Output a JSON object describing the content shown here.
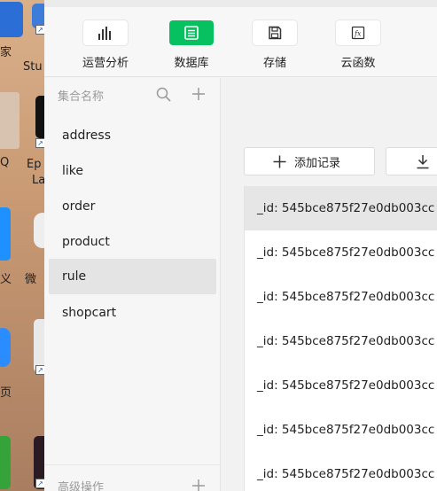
{
  "desktop": {
    "labels": [
      "家",
      "Stu",
      "Q",
      "Ep",
      "La",
      "义",
      "微",
      "页"
    ]
  },
  "toolbar": {
    "items": [
      {
        "label": "运营分析",
        "icon": "bar-chart-icon",
        "active": false
      },
      {
        "label": "数据库",
        "icon": "database-icon",
        "active": true
      },
      {
        "label": "存储",
        "icon": "save-icon",
        "active": false
      },
      {
        "label": "云函数",
        "icon": "function-icon",
        "active": false
      }
    ]
  },
  "sidebar": {
    "title": "集合名称",
    "collections": [
      "address",
      "like",
      "order",
      "product",
      "rule",
      "shopcart"
    ],
    "selected": "rule",
    "footer": "高级操作"
  },
  "main": {
    "add_record_label": "添加记录",
    "records": [
      "_id: 545bce875f27e0db003cc",
      "_id: 545bce875f27e0db003cc",
      "_id: 545bce875f27e0db003cc",
      "_id: 545bce875f27e0db003cc",
      "_id: 545bce875f27e0db003cc",
      "_id: 545bce875f27e0db003cc",
      "_id: 545bce875f27e0db003cc"
    ]
  },
  "colors": {
    "accent": "#07c160",
    "selected_row": "#e6e6e6"
  }
}
